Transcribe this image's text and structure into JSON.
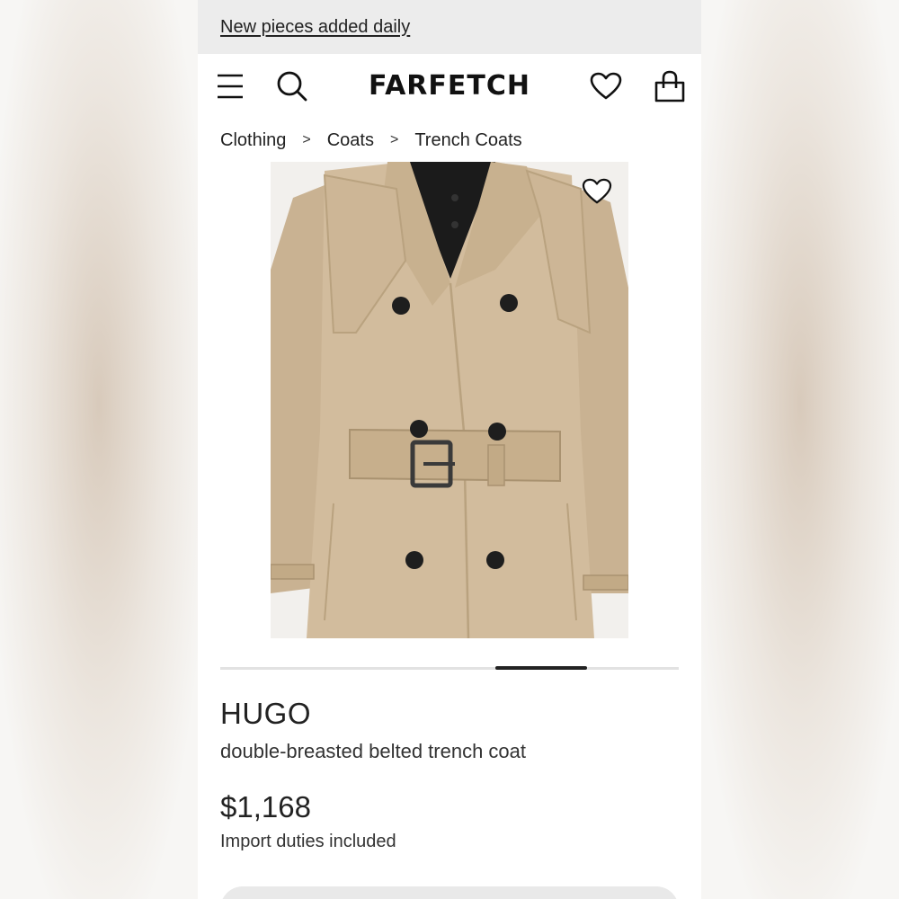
{
  "promo": {
    "text": "New pieces added daily"
  },
  "header": {
    "logo": "FARFETCH",
    "icons": [
      "menu-icon",
      "search-icon",
      "heart-icon",
      "shopping-bag-icon"
    ]
  },
  "breadcrumb": {
    "items": [
      "Clothing",
      "Coats",
      "Trench Coats"
    ],
    "separator": ">"
  },
  "gallery": {
    "image_alt": "beige double-breasted belted trench coat",
    "position_fraction": 0.6,
    "indicator_fraction": 0.2
  },
  "product": {
    "brand": "HUGO",
    "name": "double-breasted belted trench coat",
    "price": "$1,168",
    "duties_note": "Import duties included"
  },
  "colors": {
    "coat": "#d2bc9d",
    "coat_shadow": "#b9a27f",
    "shirt": "#1b1b1b",
    "button": "#1e1e1e",
    "accent": "#222222"
  }
}
